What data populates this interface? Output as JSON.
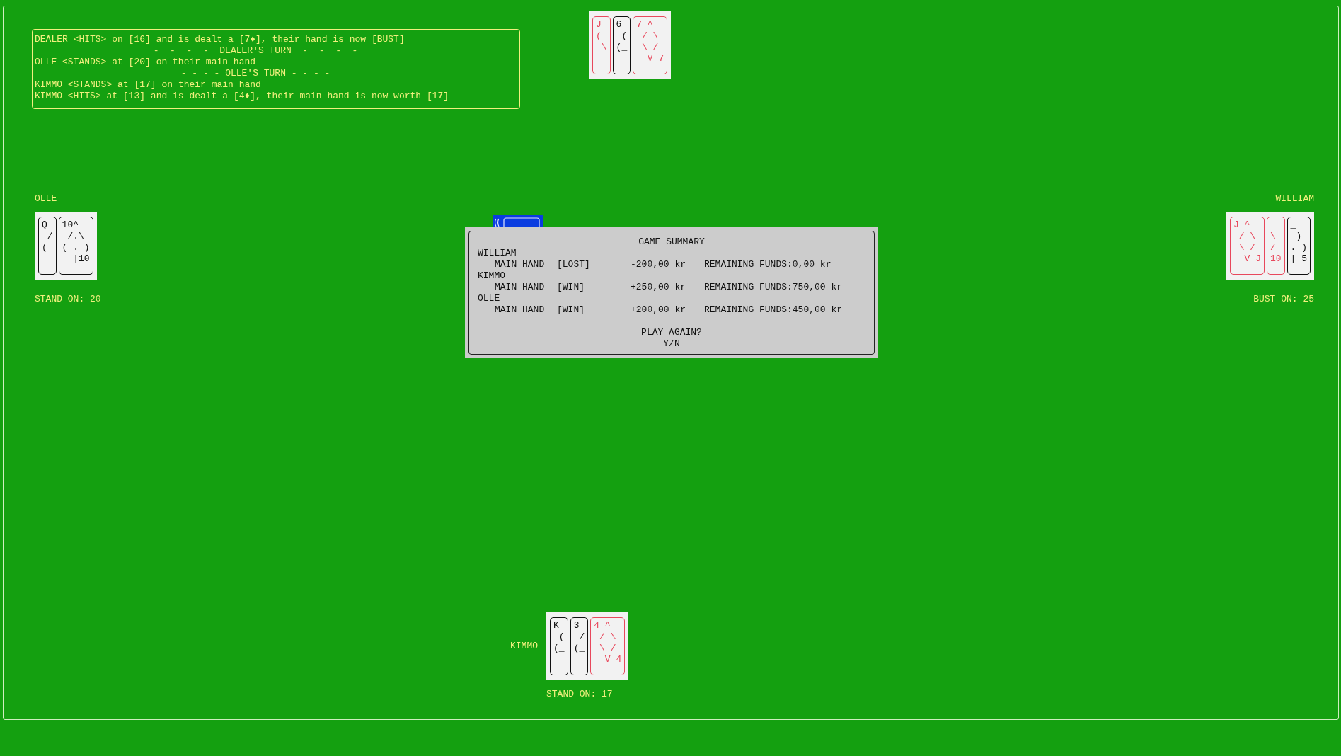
{
  "log": [
    {
      "kind": "event",
      "text": "DEALER <HITS> on [16] and is dealt a [7♦], their hand is now [BUST]"
    },
    {
      "kind": "separator",
      "text": "-  -  -  -  DEALER'S TURN  -  -  -  -"
    },
    {
      "kind": "event",
      "text": "OLLE <STANDS> at [20] on their main hand"
    },
    {
      "kind": "separator",
      "text": "- - - - OLLE'S TURN - - - -"
    },
    {
      "kind": "event",
      "text": "KIMMO <STANDS> at [17] on their main hand"
    },
    {
      "kind": "event",
      "text": "KIMMO <HITS> at [13] and is dealt a [4♦], their main hand is now worth [17]"
    }
  ],
  "dealer": {
    "cards": [
      {
        "color": "#e8485c",
        "text": "J_\n(\n \\"
      },
      {
        "color": "#111111",
        "text": "6\n (\n(_"
      },
      {
        "color": "#e8485c",
        "text": "7 ^\n / \\\n \\ /\n  V 7"
      }
    ]
  },
  "players": [
    {
      "kind": "left",
      "name": "OLLE",
      "status": "STAND ON: 20",
      "cards": [
        {
          "color": "#111111",
          "text": "Q\n /\n(_"
        },
        {
          "color": "#111111",
          "text": "10^\n /.\\\n(_._)\n  |10"
        }
      ]
    },
    {
      "kind": "right",
      "name": "WILLIAM",
      "status": "BUST ON: 25",
      "cards": [
        {
          "color": "#e8485c",
          "text": "J ^\n / \\\n \\ /\n  V J"
        },
        {
          "color": "#e8485c",
          "text": "\n\\\n/\n10"
        },
        {
          "color": "#111111",
          "text": "_\n )\n._)\n| 5"
        }
      ]
    },
    {
      "kind": "bottom",
      "name": "KIMMO",
      "status": "STAND ON: 17",
      "cards": [
        {
          "color": "#111111",
          "text": "K\n (\n(_"
        },
        {
          "color": "#111111",
          "text": "3\n /\n(_"
        },
        {
          "color": "#e8485c",
          "text": "4 ^\n / \\\n \\ /\n  V 4"
        }
      ]
    }
  ],
  "summary": {
    "title": "GAME SUMMARY",
    "results": [
      {
        "player": "WILLIAM",
        "hands": [
          {
            "hand": "MAIN HAND",
            "result": "[LOST]",
            "amount": "-200,00 kr",
            "funds": "REMAINING FUNDS:0,00 kr"
          }
        ]
      },
      {
        "player": "KIMMO",
        "hands": [
          {
            "hand": "MAIN HAND",
            "result": "[WIN]",
            "amount": "+250,00 kr",
            "funds": "REMAINING FUNDS:750,00 kr"
          }
        ]
      },
      {
        "player": "OLLE",
        "hands": [
          {
            "hand": "MAIN HAND",
            "result": "[WIN]",
            "amount": "+200,00 kr",
            "funds": "REMAINING FUNDS:450,00 kr"
          }
        ]
      }
    ],
    "prompt": "PLAY AGAIN?",
    "options": "Y/N"
  }
}
